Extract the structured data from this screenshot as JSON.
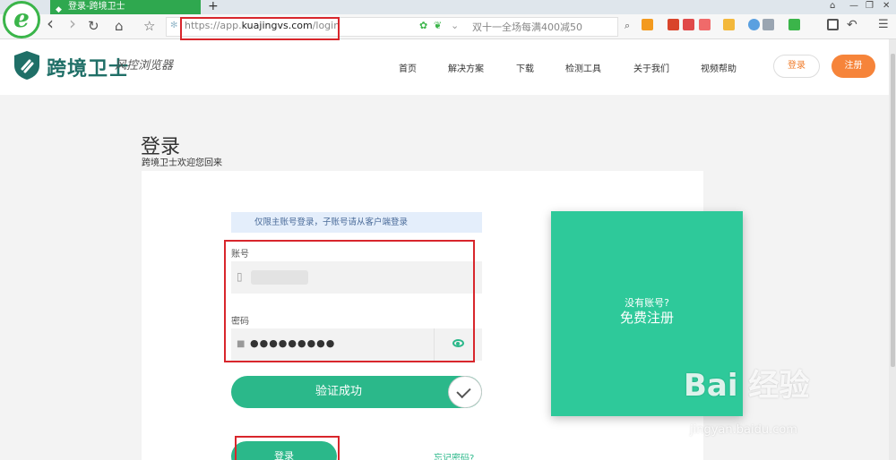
{
  "browser": {
    "logo_letter": "e",
    "tab_title": "登录-跨境卫士",
    "new_tab": "+",
    "window_controls": [
      "⌂",
      "—",
      "❐",
      "✕"
    ],
    "nav": {
      "back": "‹",
      "forward": "›",
      "reload": "↻",
      "home": "⌂",
      "favorite": "☆"
    },
    "url_prefix": "https://app.",
    "url_domain": "kuajingvs.com",
    "url_path": "/login",
    "promo": "双十一全场每满400减50",
    "menu": "☰"
  },
  "site": {
    "logo_text": "跨境卫士",
    "logo_slogan": "风控浏览器",
    "nav": [
      "首页",
      "解决方案",
      "下载",
      "检测工具",
      "关于我们",
      "视频帮助"
    ],
    "login_label": "登录",
    "register_label": "注册",
    "brand_color": "#2bb88a",
    "accent_color": "#f6843a"
  },
  "login": {
    "title": "登录",
    "subtitle": "跨境卫士欢迎您回来",
    "notice": "仅限主账号登录，子账号请从客户端登录",
    "account_label": "账号",
    "password_label": "密码",
    "password_value": "●●●●●●●●●",
    "verify_text": "验证成功",
    "submit": "登录",
    "forgot": "忘记密码?"
  },
  "register_card": {
    "question": "没有账号?",
    "cta": "免费注册"
  },
  "watermark": {
    "main": "Bai  经验",
    "sub": "jingyan.baidu.com"
  }
}
